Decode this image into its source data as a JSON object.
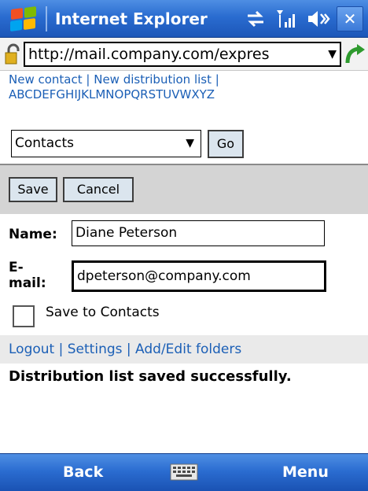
{
  "titlebar": {
    "title": "Internet Explorer",
    "close_label": "✕",
    "colors": {
      "start": "#4e8ee3",
      "end": "#1c56b8"
    }
  },
  "address": {
    "url": "http://mail.company.com/expres",
    "dropdown": "▼"
  },
  "links": {
    "new_contact": "New contact",
    "sep1": " | ",
    "new_distribution_list": "New distribution list",
    "sep2": " |",
    "alphabet": "ABCDEFGHIJKLMNOPQRSTUVWXYZ"
  },
  "folder": {
    "selected": "Contacts",
    "arrow": "▼",
    "go_label": "Go"
  },
  "actions": {
    "save": "Save",
    "cancel": "Cancel"
  },
  "form": {
    "name_label": "Name:",
    "name_value": "Diane Peterson",
    "email_label_1": "E-",
    "email_label_2": "mail:",
    "email_value": "dpeterson@company.com",
    "save_to_contacts": "Save to Contacts",
    "save_to_contacts_checked": false
  },
  "footer_links": {
    "logout": "Logout",
    "settings": "Settings",
    "add_edit_folders": "Add/Edit folders",
    "sep": " | "
  },
  "status_message": "Distribution list saved successfully.",
  "softkeys": {
    "left": "Back",
    "right": "Menu"
  },
  "icons": [
    "windows-logo-icon",
    "lock-icon",
    "go-arrow-icon",
    "connectivity-icon",
    "signal-icon",
    "volume-icon",
    "close-icon",
    "keyboard-icon"
  ]
}
